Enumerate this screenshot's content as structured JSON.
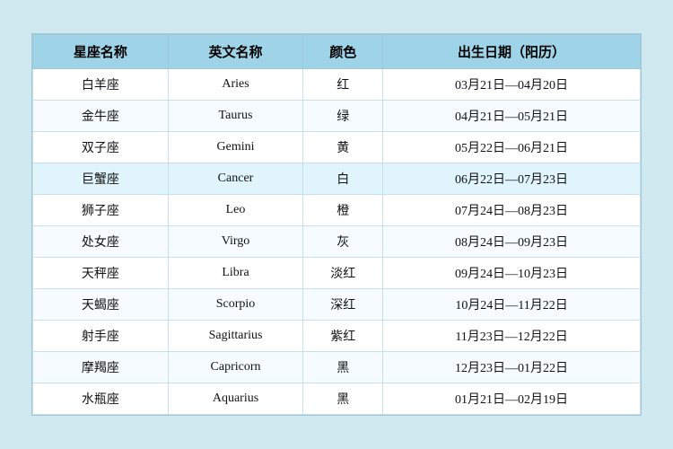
{
  "table": {
    "headers": [
      "星座名称",
      "英文名称",
      "颜色",
      "出生日期（阳历）"
    ],
    "rows": [
      {
        "chinese": "白羊座",
        "english": "Aries",
        "color": "红",
        "date": "03月21日—04月20日"
      },
      {
        "chinese": "金牛座",
        "english": "Taurus",
        "color": "绿",
        "date": "04月21日—05月21日"
      },
      {
        "chinese": "双子座",
        "english": "Gemini",
        "color": "黄",
        "date": "05月22日—06月21日"
      },
      {
        "chinese": "巨蟹座",
        "english": "Cancer",
        "color": "白",
        "date": "06月22日—07月23日",
        "highlight": true
      },
      {
        "chinese": "狮子座",
        "english": "Leo",
        "color": "橙",
        "date": "07月24日—08月23日"
      },
      {
        "chinese": "处女座",
        "english": "Virgo",
        "color": "灰",
        "date": "08月24日—09月23日"
      },
      {
        "chinese": "天秤座",
        "english": "Libra",
        "color": "淡红",
        "date": "09月24日—10月23日"
      },
      {
        "chinese": "天蝎座",
        "english": "Scorpio",
        "color": "深红",
        "date": "10月24日—11月22日"
      },
      {
        "chinese": "射手座",
        "english": "Sagittarius",
        "color": "紫红",
        "date": "11月23日—12月22日"
      },
      {
        "chinese": "摩羯座",
        "english": "Capricorn",
        "color": "黑",
        "date": "12月23日—01月22日"
      },
      {
        "chinese": "水瓶座",
        "english": "Aquarius",
        "color": "黑",
        "date": "01月21日—02月19日"
      }
    ]
  }
}
